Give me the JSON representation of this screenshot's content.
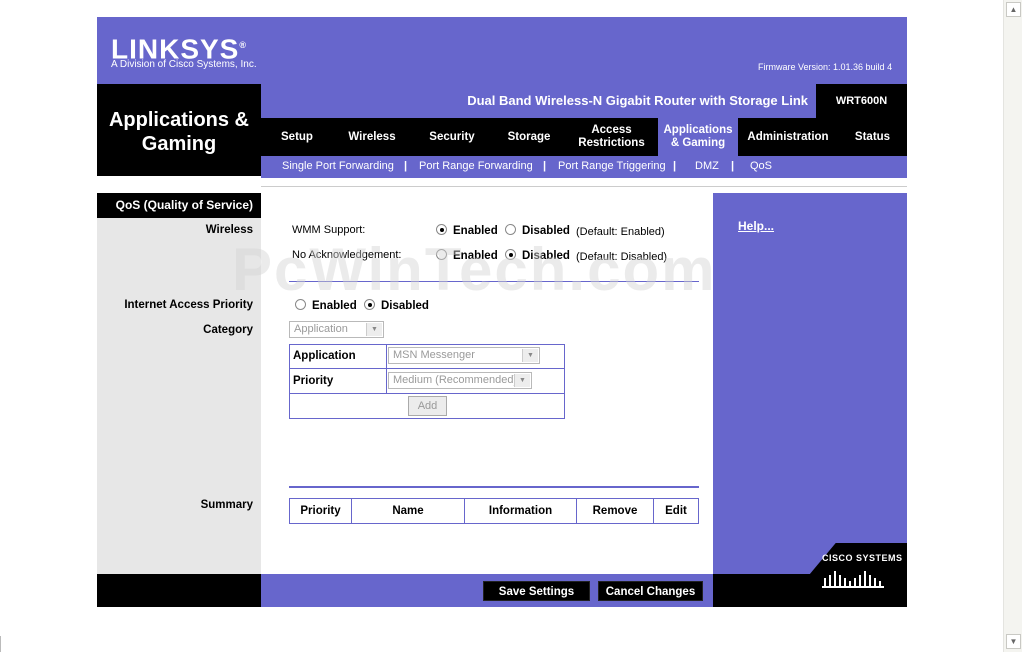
{
  "header": {
    "brand": "LINKSYS",
    "registered_mark": "®",
    "brand_sub": "A Division of Cisco Systems, Inc.",
    "firmware": "Firmware Version: 1.01.36 build 4",
    "section_title": "Applications & Gaming",
    "product": "Dual Band Wireless-N Gigabit Router with Storage Link",
    "model": "WRT600N"
  },
  "tabs": [
    {
      "label": "Setup"
    },
    {
      "label": "Wireless"
    },
    {
      "label": "Security"
    },
    {
      "label": "Storage"
    },
    {
      "label": "Access Restrictions"
    },
    {
      "label": "Applications & Gaming"
    },
    {
      "label": "Administration"
    },
    {
      "label": "Status"
    }
  ],
  "subtabs": [
    {
      "label": "Single Port Forwarding"
    },
    {
      "label": "Port Range Forwarding"
    },
    {
      "label": "Port Range Triggering"
    },
    {
      "label": "DMZ"
    },
    {
      "label": "QoS"
    }
  ],
  "subtab_separator": "|",
  "side": {
    "title": "QoS (Quality of Service)",
    "wireless": "Wireless",
    "internet_access_priority": "Internet Access Priority",
    "category": "Category",
    "summary": "Summary"
  },
  "wireless": {
    "wmm_label": "WMM Support:",
    "wmm_enabled": "Enabled",
    "wmm_disabled": "Disabled",
    "wmm_default": "(Default: Enabled)",
    "noack_label": "No Acknowledgement:",
    "noack_enabled": "Enabled",
    "noack_disabled": "Disabled",
    "noack_default": "(Default: Disabled)"
  },
  "iap": {
    "enabled": "Enabled",
    "disabled": "Disabled"
  },
  "category": {
    "value": "Application",
    "app_label": "Application",
    "app_value": "MSN Messenger",
    "priority_label": "Priority",
    "priority_value": "Medium (Recommended)",
    "add": "Add"
  },
  "summary_headers": [
    "Priority",
    "Name",
    "Information",
    "Remove",
    "Edit"
  ],
  "help": "Help...",
  "buttons": {
    "save": "Save Settings",
    "cancel": "Cancel Changes"
  },
  "cisco": "CISCO SYSTEMS",
  "watermark": "PcWinTech.com",
  "colors": {
    "accent": "#6766cc",
    "dark": "#000000",
    "panel": "#e7e7e7"
  }
}
